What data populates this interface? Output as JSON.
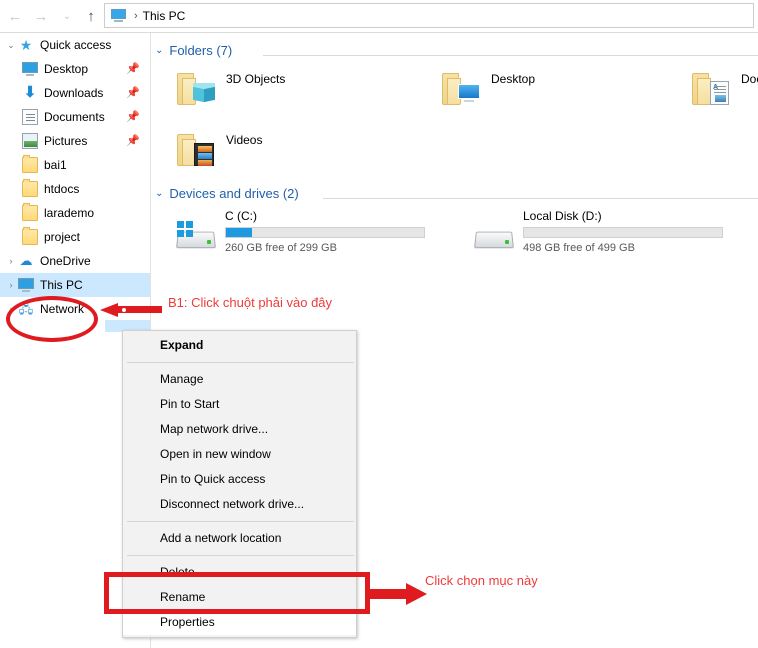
{
  "window": {
    "title": "This PC"
  },
  "nav": {
    "back_icon": "arrow-left-icon",
    "forward_icon": "arrow-right-icon",
    "recent_icon": "chevron-down-icon",
    "up_icon": "arrow-up-icon",
    "back_label": "←",
    "forward_label": "→",
    "recent_label": "⌄",
    "up_label": "↑"
  },
  "address": {
    "icon": "this-pc-icon",
    "separator": "›",
    "path": "This PC"
  },
  "sidebar": {
    "items": [
      {
        "label": "Quick access",
        "icon": "star-icon",
        "chevron": "⌄",
        "indent": 0,
        "pinned": false,
        "selected": false
      },
      {
        "label": "Desktop",
        "icon": "monitor-icon",
        "chevron": "",
        "indent": 1,
        "pinned": true,
        "selected": false
      },
      {
        "label": "Downloads",
        "icon": "download-icon",
        "chevron": "",
        "indent": 1,
        "pinned": true,
        "selected": false
      },
      {
        "label": "Documents",
        "icon": "document-icon",
        "chevron": "",
        "indent": 1,
        "pinned": true,
        "selected": false
      },
      {
        "label": "Pictures",
        "icon": "pictures-icon",
        "chevron": "",
        "indent": 1,
        "pinned": true,
        "selected": false
      },
      {
        "label": "bai1",
        "icon": "folder-icon",
        "chevron": "",
        "indent": 1,
        "pinned": false,
        "selected": false
      },
      {
        "label": "htdocs",
        "icon": "folder-icon",
        "chevron": "",
        "indent": 1,
        "pinned": false,
        "selected": false
      },
      {
        "label": "larademo",
        "icon": "folder-icon",
        "chevron": "",
        "indent": 1,
        "pinned": false,
        "selected": false
      },
      {
        "label": "project",
        "icon": "folder-icon",
        "chevron": "",
        "indent": 1,
        "pinned": false,
        "selected": false
      },
      {
        "label": "OneDrive",
        "icon": "cloud-icon",
        "chevron": "›",
        "indent": 0,
        "pinned": false,
        "selected": false
      },
      {
        "label": "This PC",
        "icon": "this-pc-icon",
        "chevron": "›",
        "indent": 0,
        "pinned": false,
        "selected": true
      },
      {
        "label": "Network",
        "icon": "network-icon",
        "chevron": "›",
        "indent": 0,
        "pinned": false,
        "selected": false
      }
    ],
    "pin_glyph": "📌"
  },
  "content": {
    "groups": [
      {
        "chevron": "⌄",
        "title": "Folders (7)"
      },
      {
        "chevron": "⌄",
        "title": "Devices and drives (2)"
      }
    ],
    "folders": [
      {
        "label": "3D Objects",
        "embed": "cube-icon"
      },
      {
        "label": "Desktop",
        "embed": "monitor-icon"
      },
      {
        "label": "Docu",
        "embed": "document-icon"
      },
      {
        "label": "Videos",
        "embed": "filmstrip-icon"
      }
    ],
    "drives": [
      {
        "name": "C (C:)",
        "free_text": "260 GB free of 299 GB",
        "used_percent": 13,
        "icon": "windows-drive-icon",
        "bar_color": "#1e9ae0"
      },
      {
        "name": "Local Disk (D:)",
        "free_text": "498 GB free of 499 GB",
        "used_percent": 0,
        "icon": "drive-icon",
        "bar_color": "#1e9ae0"
      }
    ]
  },
  "context_menu": {
    "items": [
      {
        "label": "Expand",
        "bold": true,
        "separator_after": true,
        "highlight": false
      },
      {
        "label": "Manage",
        "bold": false,
        "separator_after": false,
        "highlight": false
      },
      {
        "label": "Pin to Start",
        "bold": false,
        "separator_after": false,
        "highlight": false
      },
      {
        "label": "Map network drive...",
        "bold": false,
        "separator_after": false,
        "highlight": false
      },
      {
        "label": "Open in new window",
        "bold": false,
        "separator_after": false,
        "highlight": false
      },
      {
        "label": "Pin to Quick access",
        "bold": false,
        "separator_after": false,
        "highlight": false
      },
      {
        "label": "Disconnect network drive...",
        "bold": false,
        "separator_after": true,
        "highlight": false
      },
      {
        "label": "Add a network location",
        "bold": false,
        "separator_after": true,
        "highlight": false
      },
      {
        "label": "Delete",
        "bold": false,
        "separator_after": false,
        "highlight": false
      },
      {
        "label": "Rename",
        "bold": false,
        "separator_after": false,
        "highlight": false
      },
      {
        "label": "Properties",
        "bold": false,
        "separator_after": false,
        "highlight": true
      }
    ]
  },
  "annotations": {
    "color": "#ee3b3b",
    "shape_color": "#e01b20",
    "step1_text": "B1: Click chuột phải vào đây",
    "step2_text": "Click chọn mục này"
  }
}
